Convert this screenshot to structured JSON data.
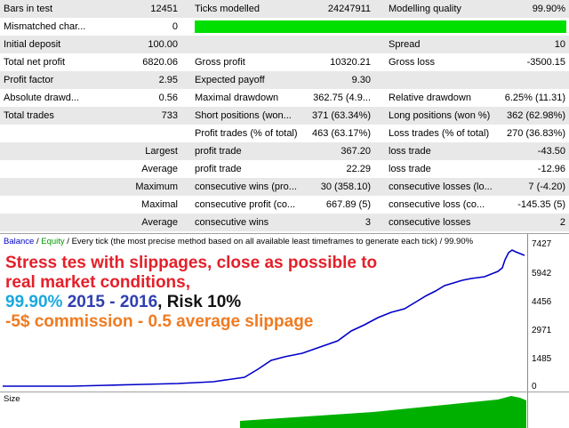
{
  "report": {
    "rows": [
      {
        "style": "alt",
        "cells": [
          {
            "text": "Bars in test",
            "x": 4,
            "w": 150,
            "align": "left"
          },
          {
            "text": "12451",
            "x": 100,
            "w": 100,
            "align": "right"
          },
          {
            "text": "Ticks modelled",
            "x": 219,
            "w": 150,
            "align": "left"
          },
          {
            "text": "24247911",
            "x": 300,
            "w": 117,
            "align": "right"
          },
          {
            "text": "Modelling quality",
            "x": 437,
            "w": 150,
            "align": "left"
          },
          {
            "text": "99.90%",
            "x": 520,
            "w": 116,
            "align": "right"
          }
        ]
      },
      {
        "style": "wht",
        "green": true,
        "cells": [
          {
            "text": "Mismatched char...",
            "x": 4,
            "w": 150,
            "align": "left"
          },
          {
            "text": "0",
            "x": 100,
            "w": 100,
            "align": "right"
          }
        ]
      },
      {
        "style": "alt",
        "cells": [
          {
            "text": "Initial deposit",
            "x": 4,
            "w": 150,
            "align": "left"
          },
          {
            "text": "100.00",
            "x": 100,
            "w": 100,
            "align": "right"
          },
          {
            "text": "Spread",
            "x": 437,
            "w": 150,
            "align": "left"
          },
          {
            "text": "10",
            "x": 520,
            "w": 116,
            "align": "right"
          }
        ]
      },
      {
        "style": "wht",
        "cells": [
          {
            "text": "Total net profit",
            "x": 4,
            "w": 150,
            "align": "left"
          },
          {
            "text": "6820.06",
            "x": 100,
            "w": 100,
            "align": "right"
          },
          {
            "text": "Gross profit",
            "x": 219,
            "w": 150,
            "align": "left"
          },
          {
            "text": "10320.21",
            "x": 300,
            "w": 117,
            "align": "right"
          },
          {
            "text": "Gross loss",
            "x": 437,
            "w": 150,
            "align": "left"
          },
          {
            "text": "-3500.15",
            "x": 520,
            "w": 116,
            "align": "right"
          }
        ]
      },
      {
        "style": "alt",
        "cells": [
          {
            "text": "Profit factor",
            "x": 4,
            "w": 150,
            "align": "left"
          },
          {
            "text": "2.95",
            "x": 100,
            "w": 100,
            "align": "right"
          },
          {
            "text": "Expected payoff",
            "x": 219,
            "w": 150,
            "align": "left"
          },
          {
            "text": "9.30",
            "x": 300,
            "w": 117,
            "align": "right"
          }
        ]
      },
      {
        "style": "wht",
        "cells": [
          {
            "text": "Absolute drawd...",
            "x": 4,
            "w": 150,
            "align": "left"
          },
          {
            "text": "0.56",
            "x": 100,
            "w": 100,
            "align": "right"
          },
          {
            "text": "Maximal drawdown",
            "x": 219,
            "w": 110,
            "align": "left"
          },
          {
            "text": "362.75 (4.9...",
            "x": 330,
            "w": 87,
            "align": "right"
          },
          {
            "text": "Relative drawdown",
            "x": 437,
            "w": 110,
            "align": "left"
          },
          {
            "text": "6.25% (11.31)",
            "x": 540,
            "w": 96,
            "align": "right"
          }
        ]
      },
      {
        "style": "alt",
        "cells": [
          {
            "text": "Total trades",
            "x": 4,
            "w": 150,
            "align": "left"
          },
          {
            "text": "733",
            "x": 100,
            "w": 100,
            "align": "right"
          },
          {
            "text": "Short positions (won...",
            "x": 219,
            "w": 120,
            "align": "left"
          },
          {
            "text": "371 (63.34%)",
            "x": 340,
            "w": 77,
            "align": "right"
          },
          {
            "text": "Long positions (won %)",
            "x": 437,
            "w": 125,
            "align": "left"
          },
          {
            "text": "362 (62.98%)",
            "x": 562,
            "w": 74,
            "align": "right"
          }
        ]
      },
      {
        "style": "wht",
        "cells": [
          {
            "text": "Profit trades (% of total)",
            "x": 219,
            "w": 130,
            "align": "left"
          },
          {
            "text": "463 (63.17%)",
            "x": 345,
            "w": 72,
            "align": "right"
          },
          {
            "text": "Loss trades (% of total)",
            "x": 437,
            "w": 125,
            "align": "left"
          },
          {
            "text": "270 (36.83%)",
            "x": 562,
            "w": 74,
            "align": "right"
          }
        ]
      },
      {
        "style": "alt",
        "cells": [
          {
            "text": "Largest",
            "x": 100,
            "w": 100,
            "align": "right"
          },
          {
            "text": "profit trade",
            "x": 219,
            "w": 150,
            "align": "left"
          },
          {
            "text": "367.20",
            "x": 300,
            "w": 117,
            "align": "right"
          },
          {
            "text": "loss trade",
            "x": 437,
            "w": 150,
            "align": "left"
          },
          {
            "text": "-43.50",
            "x": 520,
            "w": 116,
            "align": "right"
          }
        ]
      },
      {
        "style": "wht",
        "cells": [
          {
            "text": "Average",
            "x": 100,
            "w": 100,
            "align": "right"
          },
          {
            "text": "profit trade",
            "x": 219,
            "w": 150,
            "align": "left"
          },
          {
            "text": "22.29",
            "x": 300,
            "w": 117,
            "align": "right"
          },
          {
            "text": "loss trade",
            "x": 437,
            "w": 150,
            "align": "left"
          },
          {
            "text": "-12.96",
            "x": 520,
            "w": 116,
            "align": "right"
          }
        ]
      },
      {
        "style": "alt",
        "cells": [
          {
            "text": "Maximum",
            "x": 100,
            "w": 100,
            "align": "right"
          },
          {
            "text": "consecutive wins (pro...",
            "x": 219,
            "w": 125,
            "align": "left"
          },
          {
            "text": "30 (358.10)",
            "x": 340,
            "w": 77,
            "align": "right"
          },
          {
            "text": "consecutive losses (lo...",
            "x": 437,
            "w": 125,
            "align": "left"
          },
          {
            "text": "7 (-4.20)",
            "x": 562,
            "w": 74,
            "align": "right"
          }
        ]
      },
      {
        "style": "wht",
        "cells": [
          {
            "text": "Maximal",
            "x": 100,
            "w": 100,
            "align": "right"
          },
          {
            "text": "consecutive profit (co...",
            "x": 219,
            "w": 125,
            "align": "left"
          },
          {
            "text": "667.89 (5)",
            "x": 340,
            "w": 77,
            "align": "right"
          },
          {
            "text": "consecutive loss (co...",
            "x": 437,
            "w": 125,
            "align": "left"
          },
          {
            "text": "-145.35 (5)",
            "x": 562,
            "w": 74,
            "align": "right"
          }
        ]
      },
      {
        "style": "alt",
        "cells": [
          {
            "text": "Average",
            "x": 100,
            "w": 100,
            "align": "right"
          },
          {
            "text": "consecutive wins",
            "x": 219,
            "w": 150,
            "align": "left"
          },
          {
            "text": "3",
            "x": 300,
            "w": 117,
            "align": "right"
          },
          {
            "text": "consecutive losses",
            "x": 437,
            "w": 150,
            "align": "left"
          },
          {
            "text": "2",
            "x": 520,
            "w": 116,
            "align": "right"
          }
        ]
      }
    ]
  },
  "graph": {
    "legend": {
      "balance": "Balance",
      "sep": " / ",
      "equity": "Equity",
      "rest": " / Every tick (the most precise method based on all available least timeframes to generate each tick) / 99.90%"
    },
    "overlay": {
      "line1": "Stress tes with slippages, close as possible to",
      "line2": "real market conditions,",
      "line3a": "99.90%",
      "line3b": " 2015 - 2016",
      "line3c": ", Risk 10%",
      "line4": "-5$ commission - 0.5 average slippage"
    },
    "y_ticks": [
      "7427",
      "5942",
      "4456",
      "2971",
      "1485",
      "0"
    ],
    "size_label": "Size",
    "colors": {
      "balance": "#0000c8",
      "equity": "#009b00",
      "size": "#00b000"
    }
  }
}
